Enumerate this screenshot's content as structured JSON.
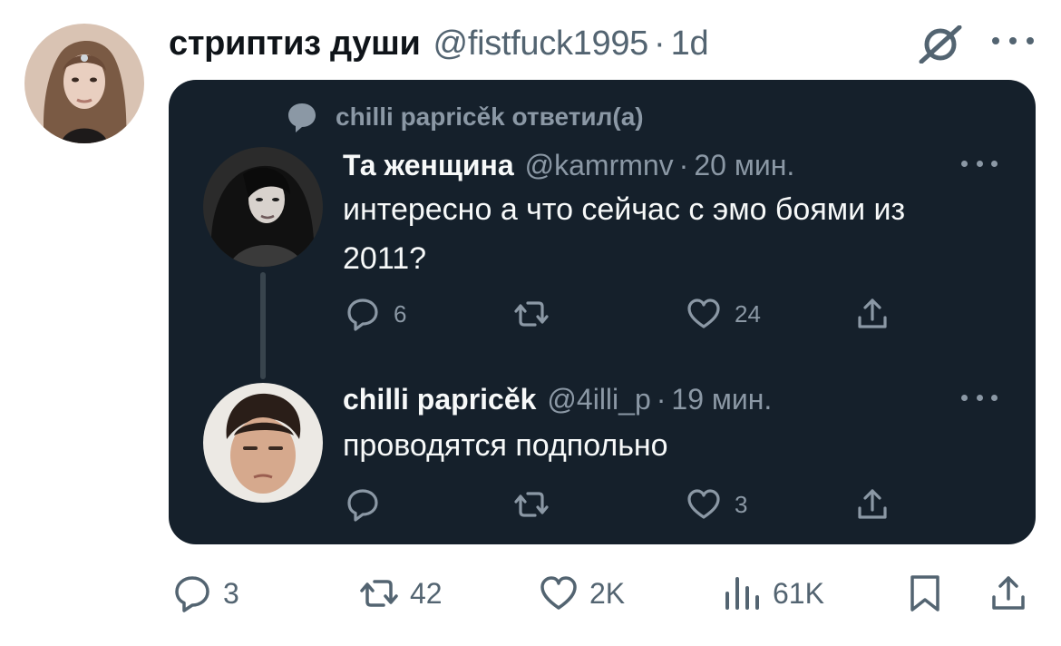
{
  "tweet": {
    "display_name": "стриптиз души",
    "handle": "@fistfuck1995",
    "separator": "·",
    "time": "1d",
    "stats": {
      "replies": "3",
      "retweets": "42",
      "likes": "2K",
      "views": "61K"
    }
  },
  "quote": {
    "replied_label": "chilli papricěk ответил(а)",
    "parent": {
      "display_name": "Та женщина",
      "handle": "@kamrmnv",
      "separator": "·",
      "time": "20 мин.",
      "text": "интересно а что сейчас с эмо боями из 2011?",
      "replies": "6",
      "retweets": "",
      "likes": "24"
    },
    "reply": {
      "display_name": "chilli papricěk",
      "handle": "@4illi_p",
      "separator": "·",
      "time": "19 мин.",
      "text": "проводятся подпольно",
      "replies": "",
      "retweets": "",
      "likes": "3"
    }
  },
  "icons": {
    "grok": "slashed-circle-icon",
    "more": "more-dots-icon",
    "reply": "reply-bubble-icon",
    "retweet": "retweet-icon",
    "like": "heart-icon",
    "share": "share-icon",
    "views": "views-bars-icon",
    "bookmark": "bookmark-icon"
  },
  "colors": {
    "card_bg": "#15202b",
    "text_dark": "#0f1419",
    "muted": "#536471",
    "muted_dark": "#8b98a5"
  }
}
